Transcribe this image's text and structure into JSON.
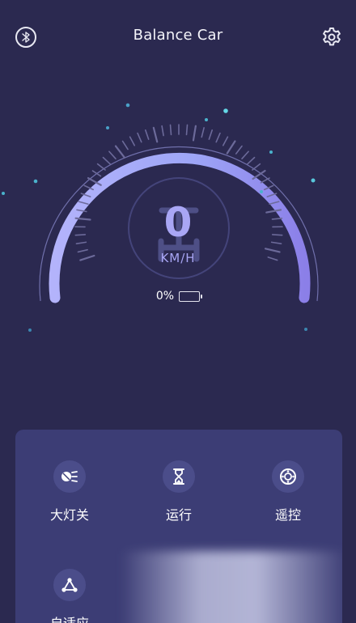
{
  "app": {
    "title": "Balance Car"
  },
  "header": {
    "bluetooth_icon": "bluetooth-icon",
    "settings_icon": "gear-icon"
  },
  "gauge": {
    "speed": "0",
    "unit": "KM/H",
    "battery_percent": "0%",
    "battery_level": 0,
    "arc_colors": [
      "#a6a4f6",
      "#7f8cf0"
    ],
    "tick_color": "#6c6a9a"
  },
  "controls": [
    {
      "label": "大灯关",
      "icon": "headlight-icon"
    },
    {
      "label": "运行",
      "icon": "hourglass-icon"
    },
    {
      "label": "遥控",
      "icon": "remote-control-icon"
    },
    {
      "label": "自适应",
      "icon": "adaptive-icon"
    }
  ],
  "colors": {
    "background": "#2b2950",
    "panel": "#3c3d75",
    "accent": "#a9a6f5"
  }
}
